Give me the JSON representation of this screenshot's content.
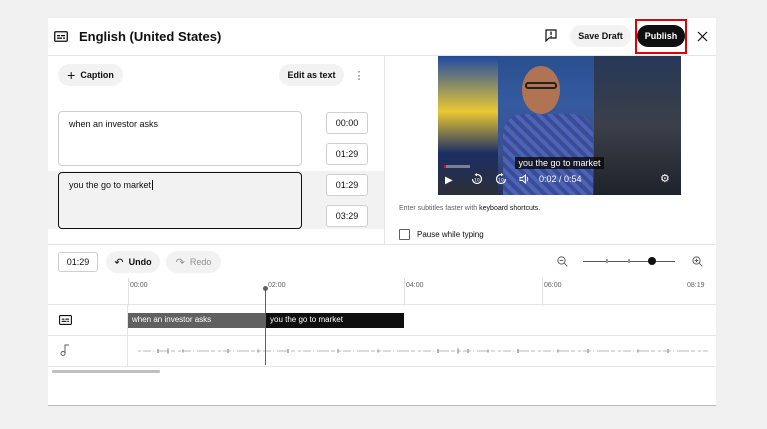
{
  "header": {
    "title": "English (United States)",
    "save_draft_label": "Save Draft",
    "publish_label": "Publish"
  },
  "editor": {
    "add_caption_label": "Caption",
    "edit_as_text_label": "Edit as text",
    "captions": [
      {
        "text": "when an investor asks",
        "start": "00:00",
        "end": "01:29"
      },
      {
        "text": "you the go to market",
        "start": "01:29",
        "end": "03:29"
      }
    ]
  },
  "video": {
    "caption_overlay": "you the go to market",
    "time_display": "0:02 / 0:54",
    "progress_fraction": 0.04,
    "hint_prefix": "Enter subtitles faster with ",
    "hint_link": "keyboard shortcuts.",
    "pause_while_typing_label": "Pause while typing",
    "pause_while_typing_checked": false
  },
  "timeline": {
    "current_time": "01:29",
    "undo_label": "Undo",
    "redo_label": "Redo",
    "ticks": [
      "00:00",
      "02:00",
      "04:00",
      "06:00",
      "08:19"
    ],
    "segments": [
      "when an investor asks",
      "you the go to market"
    ],
    "zoom_level_fraction": 0.7
  },
  "colors": {
    "accent": "#0f0f0f",
    "highlight": "#e00000",
    "progress": "#ff0000"
  }
}
